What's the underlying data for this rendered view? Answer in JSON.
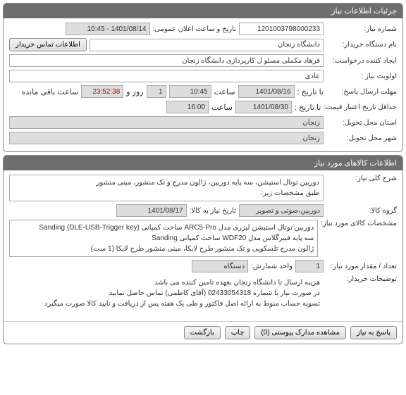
{
  "sec1": {
    "title": "جزئیات اطلاعات نیاز",
    "need_no_label": "شماره نیاز:",
    "need_no": "1201003798000233",
    "pub_date_label": "تاریخ و ساعت اعلان عمومی:",
    "pub_date": "1401/08/14 - 10:45",
    "buyer_org_label": "نام دستگاه خریدار:",
    "buyer_org": "دانشگاه زنجان",
    "buyer_contact_btn": "اطلاعات تماس خریدار",
    "creator_label": "ایجاد کننده درخواست:",
    "creator": "فرهاد مکملی مسئو ل کارپردازی دانشگاه زنجان",
    "priority_label": "اولویت نیاز :",
    "priority": "عادی",
    "deadline_label": "مهلت ارسال پاسخ:",
    "to_date_label": "تا تاریخ :",
    "deadline_date": "1401/08/16",
    "time_label": "ساعت",
    "deadline_time": "10:45",
    "days_remaining": "1",
    "days_label": "روز و",
    "countdown": "23:52:38",
    "remaining_label": "ساعت باقی مانده",
    "validity_label": "حداقل تاریخ اعتبار قیمت:",
    "validity_date": "1401/08/30",
    "validity_time": "16:00",
    "dest_province_label": "استان محل تحویل:",
    "dest_province": "زنجان",
    "dest_city_label": "شهر محل تحویل:",
    "dest_city": "زنجان"
  },
  "sec2": {
    "title": "اطلاعات کالاهای مورد نیاز",
    "general_desc_label": "شرح کلی نیاز:",
    "general_desc": "دوربین توتال استیشن، سه پایه دوربین، ژالون مدرج و تک منشور، مینی منشور\nطبق مشخصات زیر:",
    "group_label": "گروه کالا:",
    "group": "دوربین،صوتی و تصویر",
    "need_by_label": "تاریخ نیاز به کالا:",
    "need_by": "1401/08/17",
    "spec_label": "مشخصات کالای مورد نیاز:",
    "spec": "دوربین توتال استیشن لیزری مدل ARC5-Pro ساخت کمپانی Sanding (DLE-USB-Trigger key)\nسه پایه فیبرگلاس مدل WDF20 ساخت کمپانی Sanding\nژالون مدرج تلسکوپی و تک منشور طرح لایکا، مینی منشور طرح لایکا (1 ست)",
    "qty_label": "تعداد / مقدار مورد نیاز:",
    "qty": "1",
    "unit_label": "واحد شمارش:",
    "unit": "دستگاه",
    "buyer_notes_label": "توضیحات خریدار:",
    "buyer_notes": "هزینه ارسال تا دانشگاه زنجان بعهده تامین کننده می باشد\nدر صورت نیاز با شماره 02433054318 (آقای کاظمی) تماس حاصل نمایید\nتسویه حساب منوط به ارائه اصل فاکتور و طی یک هفته پس از دریافت و تایید کالا صورت میگیرد"
  },
  "buttons": {
    "reply": "پاسخ به نیاز",
    "attachments": "مشاهده مدارک پیوستی (0)",
    "print": "چاپ",
    "back": "بازگشت"
  }
}
